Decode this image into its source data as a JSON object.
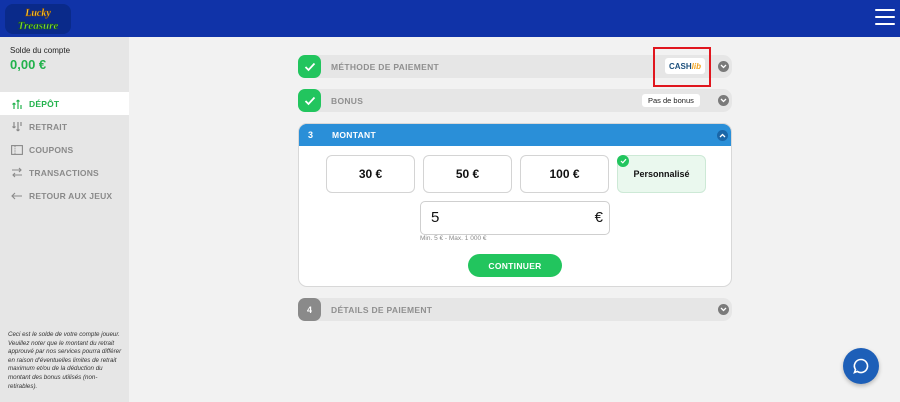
{
  "header": {
    "logo_alt": "Lucky Treasure",
    "logo_line1": "Lucky",
    "logo_line2": "Treasure"
  },
  "sidebar": {
    "balance_label": "Solde du compte",
    "balance_value": "0,00 €",
    "items": [
      {
        "label": "DÉPÔT",
        "icon": "deposit-icon",
        "active": true
      },
      {
        "label": "RETRAIT",
        "icon": "withdraw-icon",
        "active": false
      },
      {
        "label": "COUPONS",
        "icon": "coupon-icon",
        "active": false
      },
      {
        "label": "TRANSACTIONS",
        "icon": "transactions-icon",
        "active": false
      },
      {
        "label": "RETOUR AUX JEUX",
        "icon": "back-arrow-icon",
        "active": false
      }
    ],
    "note": "Ceci est le solde de votre compte joueur. Veuillez noter que le montant du retrait approuvé par nos services pourra différer en raison d'éventuelles limites de retrait maximum et/ou de la déduction du montant des bonus utilisés (non-retirables)."
  },
  "steps": {
    "payment_method": {
      "title": "MÉTHODE DE PAIEMENT",
      "selected_brand": "CASH",
      "selected_brand_suffix": "lib"
    },
    "bonus": {
      "title": "BONUS",
      "value": "Pas de bonus"
    },
    "amount": {
      "number": "3",
      "title": "MONTANT",
      "options": [
        "30 €",
        "50 €",
        "100 €",
        "Personnalisé"
      ],
      "selected_index": 3,
      "input_value": "5",
      "currency": "€",
      "limits": "Min. 5 € - Max. 1 000 €",
      "continue_label": "CONTINUER"
    },
    "details": {
      "number": "4",
      "title": "DÉTAILS DE PAIEMENT"
    }
  },
  "colors": {
    "brand_blue": "#1033a8",
    "accent_green": "#22c55e",
    "step_blue": "#2a8fd8",
    "highlight_red": "#e0161e"
  }
}
